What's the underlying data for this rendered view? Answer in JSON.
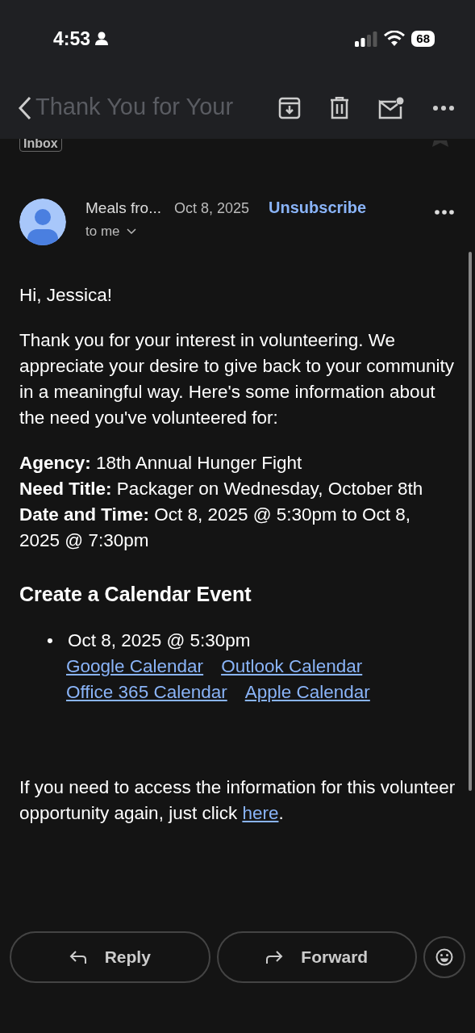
{
  "status_bar": {
    "time": "4:53",
    "battery": "68"
  },
  "toolbar": {
    "title": "Thank You for Your"
  },
  "label": "Inbox",
  "sender": {
    "name": "Meals fro...",
    "date": "Oct 8, 2025",
    "recipient": "to me",
    "unsubscribe": "Unsubscribe"
  },
  "body": {
    "greeting": "Hi, Jessica!",
    "intro": "Thank you for your interest in volunteering. We appreciate your desire to give back to your community in a meaningful way. Here's some information about the need you've volunteered for:",
    "details": [
      "**Agency:** 18th Annual Hunger Fight",
      "**Need Title:** Packager on Wednesday, October 8th",
      "**Date and Time:** Oct 8, 2025 @ 5:30pm to Oct 8, 2025 @ 7:30pm"
    ],
    "heading": "Create a Calendar Event",
    "event": {
      "bullet": "•",
      "when": "Oct 8, 2025 @ 5:30pm",
      "links": [
        "Google Calendar",
        "Outlook Calendar",
        "Office 365 Calendar",
        "Apple Calendar"
      ]
    },
    "footer": {
      "text": "If you need to access the information for this volunteer opportunity again, just click ",
      "link": "here",
      "after": "."
    }
  },
  "actions": [
    "Reply",
    "Forward"
  ]
}
